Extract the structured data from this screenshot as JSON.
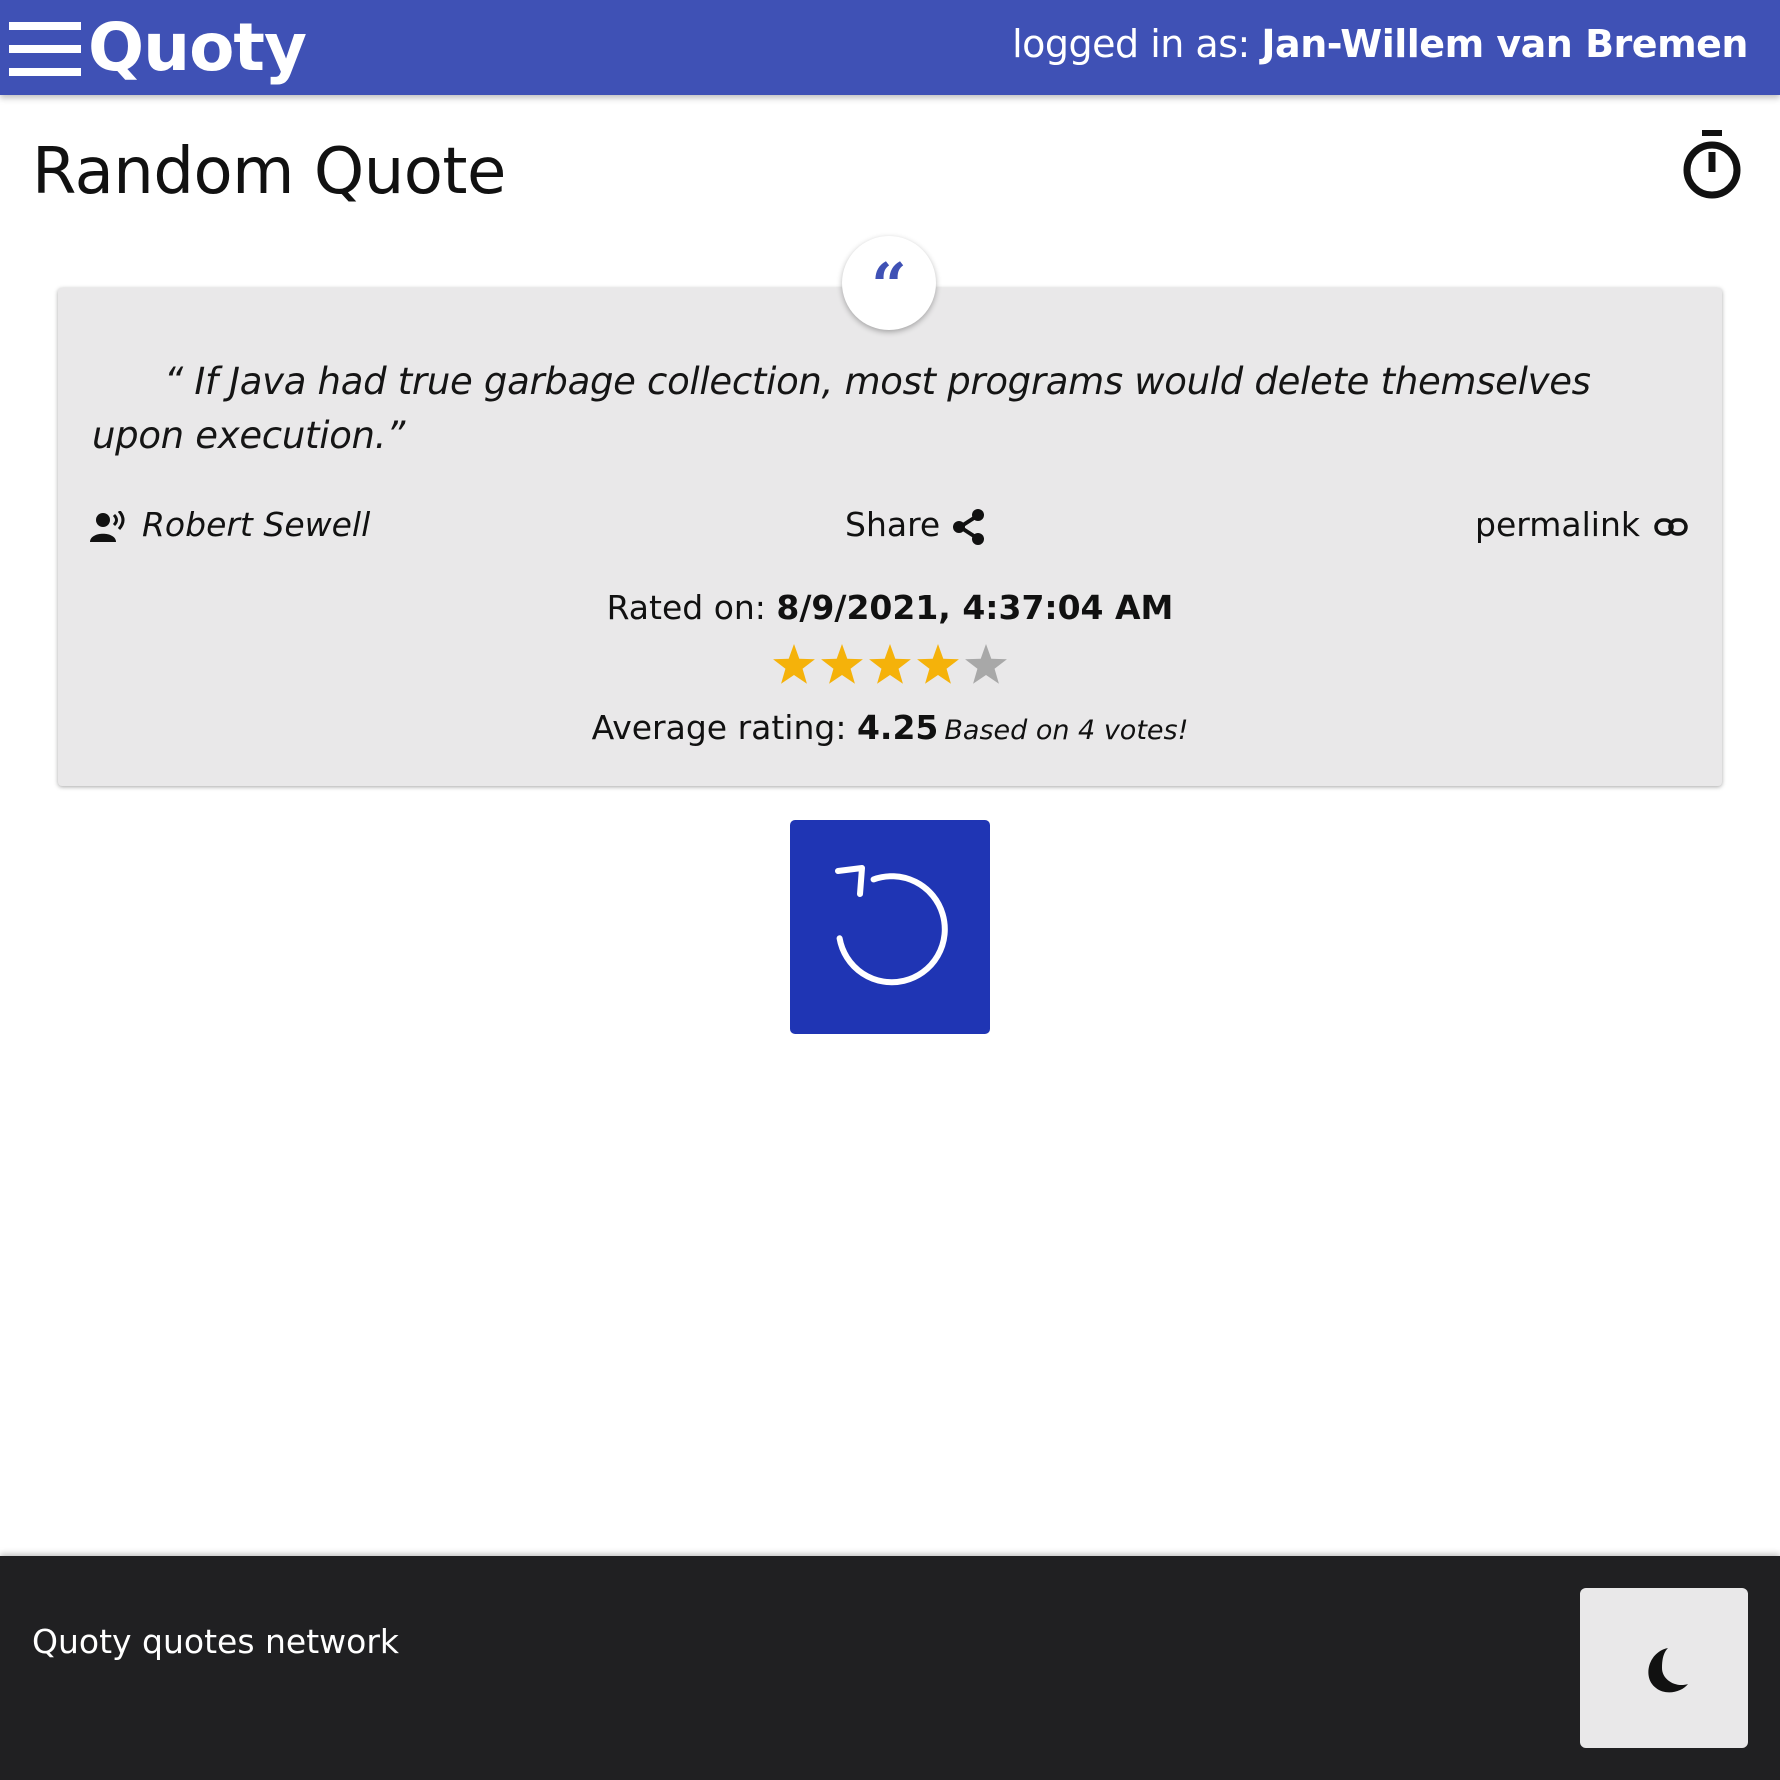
{
  "header": {
    "logo": "Quoty",
    "login_prefix": "logged in as: ",
    "username": "Jan-Willem van Bremen"
  },
  "page": {
    "title": "Random Quote"
  },
  "quote": {
    "badge_glyph": "“",
    "text": "“ If Java had true garbage collection, most programs would delete themselves upon execution.”",
    "author": "Robert Sewell",
    "share_label": "Share",
    "permalink_label": "permalink",
    "rated_prefix": "Rated on: ",
    "rated_value": "8/9/2021, 4:37:04 AM",
    "user_rating": 4,
    "max_rating": 5,
    "average_prefix": "Average rating: ",
    "average_value": "4.25",
    "votes_text": "Based on 4 votes!"
  },
  "colors": {
    "header_bg": "#3f51b5",
    "star_filled": "#f5b20a",
    "star_empty": "#a8a8a8",
    "refresh_bg": "#1f35b4",
    "footer_bg": "#202022"
  },
  "icons": {
    "menu": "hamburger-menu-icon",
    "timer": "timer-icon",
    "quote": "quote-mark-icon",
    "author": "speaker-person-icon",
    "share": "share-icon",
    "permalink": "link-icon",
    "refresh": "refresh-icon",
    "theme": "moon-icon"
  },
  "footer": {
    "text": "Quoty quotes network"
  }
}
